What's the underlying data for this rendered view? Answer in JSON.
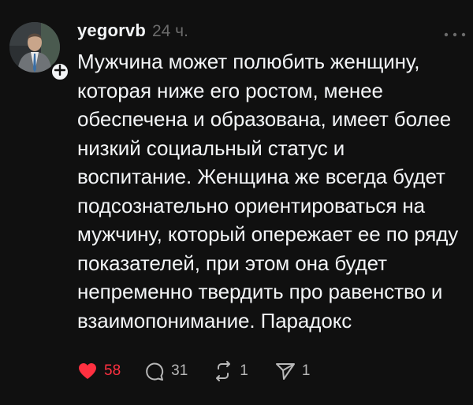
{
  "post": {
    "author": {
      "username": "yegorvb"
    },
    "timestamp": "24 ч.",
    "text": "Мужчина может полюбить женщину,\nкоторая ниже его ростом, менее\nобеспечена и образована, имеет более\nнизкий социальный статус и\nвоспитание. Женщина же всегда будет\nподсознательно ориентироваться на\nмужчину, который опережает ее по ряду\nпоказателей, при этом она будет\nнепременно твердить про равенство и\nвзаимопонимание. Парадокс",
    "actions": {
      "likes": "58",
      "replies": "31",
      "reposts": "1",
      "shares": "1"
    }
  },
  "icons": {
    "follow": "plus-icon",
    "more": "more-horizontal-icon",
    "like": "heart-filled-icon",
    "reply": "comment-bubble-icon",
    "repost": "repost-icon",
    "share": "send-icon"
  },
  "colors": {
    "background": "#101010",
    "text": "#f3f5f7",
    "secondary": "#6b6b6b",
    "like": "#ff3040"
  }
}
